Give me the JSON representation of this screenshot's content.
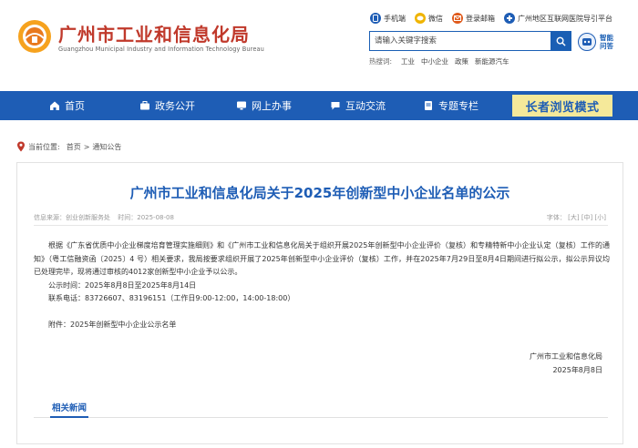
{
  "site": {
    "title": "广州市工业和信息化局",
    "subtitle": "Guangzhou Municipal Industry and Information Technology Bureau"
  },
  "toplinks": [
    {
      "label": "手机端",
      "icon": "mobile-icon",
      "color": "#1e5db5"
    },
    {
      "label": "微信",
      "icon": "wechat-icon",
      "color": "#f0b400"
    },
    {
      "label": "登录邮箱",
      "icon": "mail-icon",
      "color": "#e05a1b"
    },
    {
      "label": "广州地区互联网医院导引平台",
      "icon": "hospital-icon",
      "color": "#1e5db5"
    }
  ],
  "search": {
    "placeholder": "请输入关键字搜索",
    "smart_label_1": "智能",
    "smart_label_2": "问答"
  },
  "hotwords": {
    "label": "热搜词:",
    "items": [
      "工业",
      "中小企业",
      "政策",
      "新能源汽车"
    ]
  },
  "nav": {
    "items": [
      "首页",
      "政务公开",
      "网上办事",
      "互动交流",
      "专题专栏"
    ],
    "elder_mode": "长者浏览模式"
  },
  "breadcrumb": {
    "label": "当前位置:",
    "home": "首页",
    "sep": ">",
    "current": "通知公告"
  },
  "article": {
    "title": "广州市工业和信息化局关于2025年创新型中小企业名单的公示",
    "source": "信息来源：创业创新服务处",
    "time": "时间：2025-08-08",
    "font_label": "字体：",
    "font_large": "[大]",
    "font_medium": "[中]",
    "font_small": "[小]",
    "paragraph": "根据《广东省优质中小企业梯度培育管理实施细则》和《广州市工业和信息化局关于组织开展2025年创新型中小企业评价（复核）和专精特新中小企业认定（复核）工作的通知》（粤工信融资函〔2025〕4 号）相关要求，我局按要求组织开展了2025年创新型中小企业评价（复核）工作，并在2025年7月29日至8月4日期间进行拟公示，拟公示异议均已处理完毕，现将通过审核的4012家创新型中小企业予以公示。",
    "period": "公示时间：2025年8月8日至2025年8月14日",
    "phone": "联系电话：83726607、83196151（工作日9:00-12:00，14:00-18:00）",
    "attachment": "附件：2025年创新型中小企业公示名单",
    "sign_org": "广州市工业和信息化局",
    "sign_date": "2025年8月8日"
  },
  "related": {
    "tab": "相关新闻"
  }
}
